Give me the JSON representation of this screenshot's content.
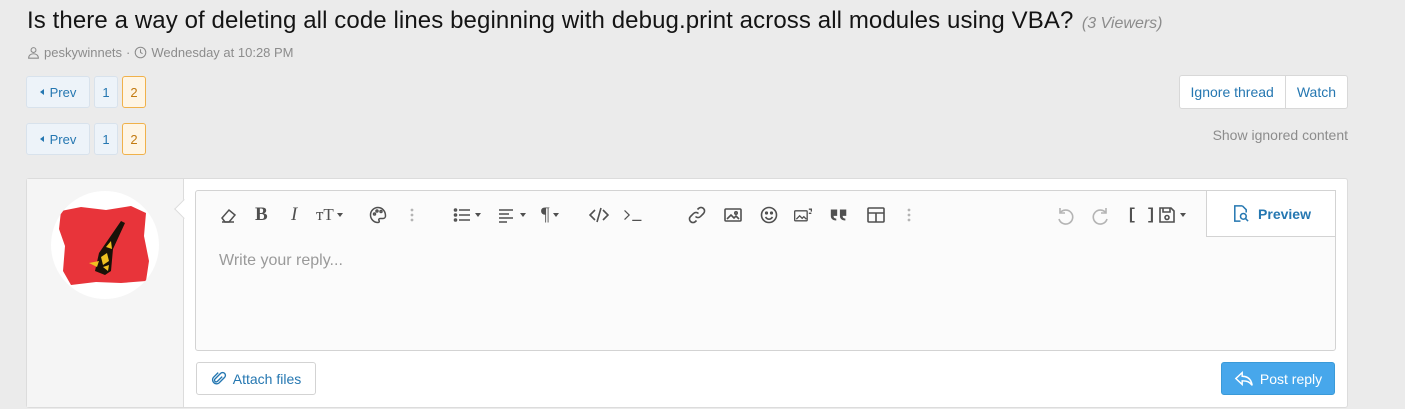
{
  "thread": {
    "title": "Is there a way of deleting all code lines beginning with debug.print across all modules using VBA?",
    "viewers": "(3 Viewers)",
    "author": "peskywinnets",
    "separator": "·",
    "date": "Wednesday at 10:28 PM"
  },
  "pagination": {
    "prev_label": "Prev",
    "pages": [
      "1",
      "2"
    ],
    "current_page": "2"
  },
  "actions": {
    "ignore_label": "Ignore thread",
    "watch_label": "Watch",
    "show_ignored_label": "Show ignored content"
  },
  "editor": {
    "placeholder": "Write your reply...",
    "preview_label": "Preview",
    "toolbar_icons": [
      "eraser-icon",
      "bold-icon",
      "italic-icon",
      "text-size-icon",
      "palette-icon",
      "more-vertical-icon",
      "list-icon",
      "align-icon",
      "paragraph-icon",
      "inline-code-icon",
      "code-block-icon",
      "link-icon",
      "image-icon",
      "smiley-icon",
      "media-icon",
      "quote-icon",
      "table-icon",
      "more-vertical-icon",
      "undo-icon",
      "redo-icon",
      "bbcode-icon",
      "drafts-icon"
    ]
  },
  "footer": {
    "attach_label": "Attach files",
    "post_label": "Post reply"
  },
  "colors": {
    "link": "#2577b1",
    "post_button": "#47a7eb",
    "current_page_border": "#f0b14a",
    "background": "#ebebeb"
  }
}
